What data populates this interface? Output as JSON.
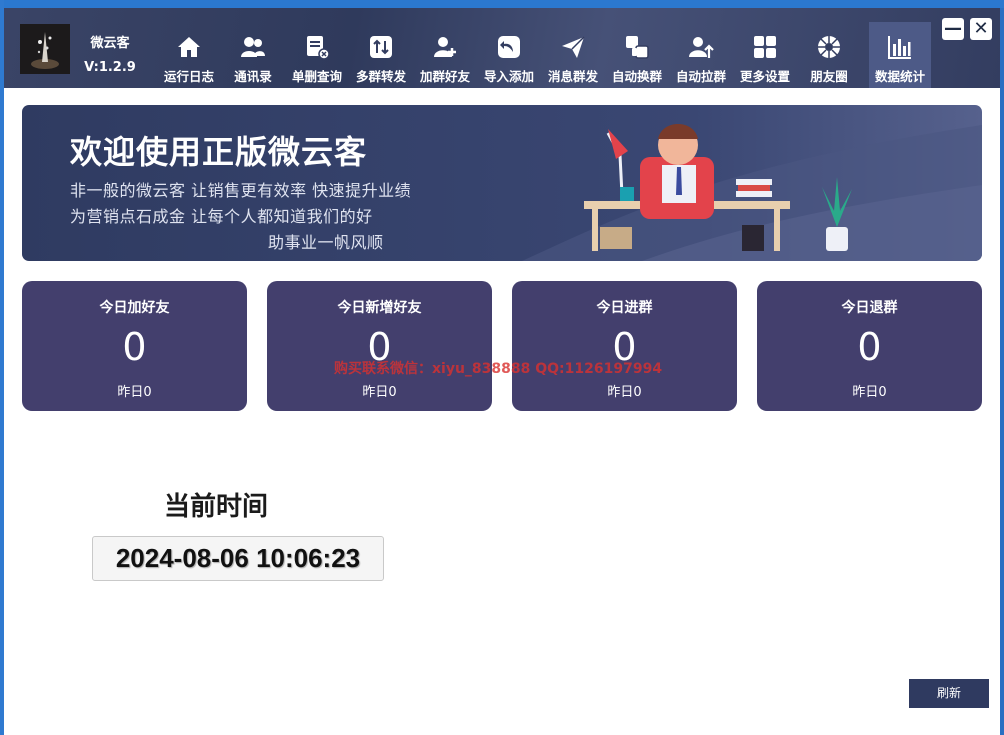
{
  "app": {
    "name": "微云客",
    "version": "V:1.2.9"
  },
  "nav": [
    {
      "label": "运行日志",
      "icon": "home-icon"
    },
    {
      "label": "通讯录",
      "icon": "contacts-icon"
    },
    {
      "label": "单删查询",
      "icon": "delete-check-icon"
    },
    {
      "label": "多群转发",
      "icon": "forward-icon"
    },
    {
      "label": "加群好友",
      "icon": "add-friend-icon"
    },
    {
      "label": "导入添加",
      "icon": "import-icon"
    },
    {
      "label": "消息群发",
      "icon": "send-icon"
    },
    {
      "label": "自动换群",
      "icon": "switch-group-icon"
    },
    {
      "label": "自动拉群",
      "icon": "pull-group-icon"
    },
    {
      "label": "更多设置",
      "icon": "grid-icon"
    },
    {
      "label": "朋友圈",
      "icon": "moments-icon"
    },
    {
      "label": "数据统计",
      "icon": "chart-icon"
    }
  ],
  "window_controls": {
    "minimize": "—",
    "close": "✕"
  },
  "banner": {
    "title": "欢迎使用正版微云客",
    "line1": "非一般的微云客  让销售更有效率  快速提升业绩",
    "line2": "为营销点石成金  让每个人都知道我们的好",
    "line3": "助事业一帆风顺"
  },
  "stats": [
    {
      "title": "今日加好友",
      "value": "0",
      "yesterday": "昨日0"
    },
    {
      "title": "今日新增好友",
      "value": "0",
      "yesterday": "昨日0"
    },
    {
      "title": "今日进群",
      "value": "0",
      "yesterday": "昨日0"
    },
    {
      "title": "今日退群",
      "value": "0",
      "yesterday": "昨日0"
    }
  ],
  "watermark": "购买联系微信：xiyu_838888    QQ:1126197994",
  "clock": {
    "label": "当前时间",
    "value": "2024-08-06 10:06:23"
  },
  "refresh_label": "刷新",
  "colors": {
    "header": "#333d60",
    "card": "#433f6d",
    "active_tab": "#4d5a87",
    "accent_blue": "#2b78cf"
  }
}
